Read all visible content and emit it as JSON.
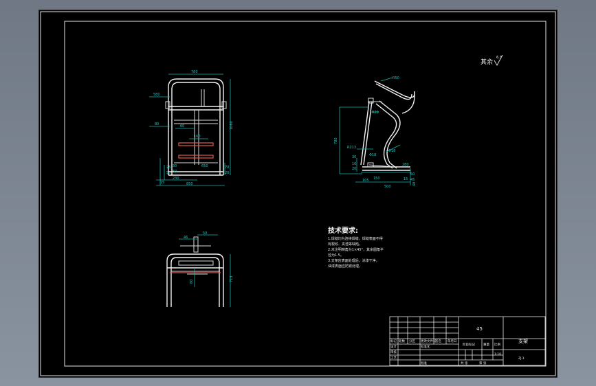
{
  "drawing": {
    "roughness_note": "其余",
    "roughness_value": "6.3"
  },
  "front_view": {
    "dims": [
      "760",
      "580",
      "1060",
      "60",
      "160",
      "80",
      "650",
      "230",
      "850",
      "30",
      "50",
      "70",
      "20",
      "15",
      "25",
      "50"
    ]
  },
  "side_view": {
    "dims": [
      "R50",
      "R20",
      "780",
      "R213",
      "Φ18",
      "Φ18",
      "30",
      "105",
      "500",
      "10",
      "20",
      "280",
      "50",
      "15",
      "45",
      "40",
      "150"
    ]
  },
  "top_view": {
    "dims": [
      "46",
      "50",
      "713",
      "80"
    ]
  },
  "notes": {
    "title": "技术要求:",
    "lines": [
      "1.焊缝均为连续焊缝，焊缝表面不得",
      "有裂纹、夹渣等缺陷。",
      "2.未注明倒角为1×45°，其余圆角半",
      "径为1.5。",
      "3.支架应表面处理后，涂漆干净，",
      "油漆表面应防锈处理。"
    ]
  },
  "title_block": {
    "material": "45",
    "part_name": "支架",
    "drawing_no": "ZJ-1",
    "scale": "1:10",
    "labels": [
      "标记",
      "处数",
      "分区",
      "更改文件号",
      "签名",
      "年月日",
      "设计",
      "审核",
      "工艺",
      "标准化",
      "批准",
      "阶段标记",
      "重量",
      "比例",
      "共 张",
      "第 张"
    ]
  }
}
